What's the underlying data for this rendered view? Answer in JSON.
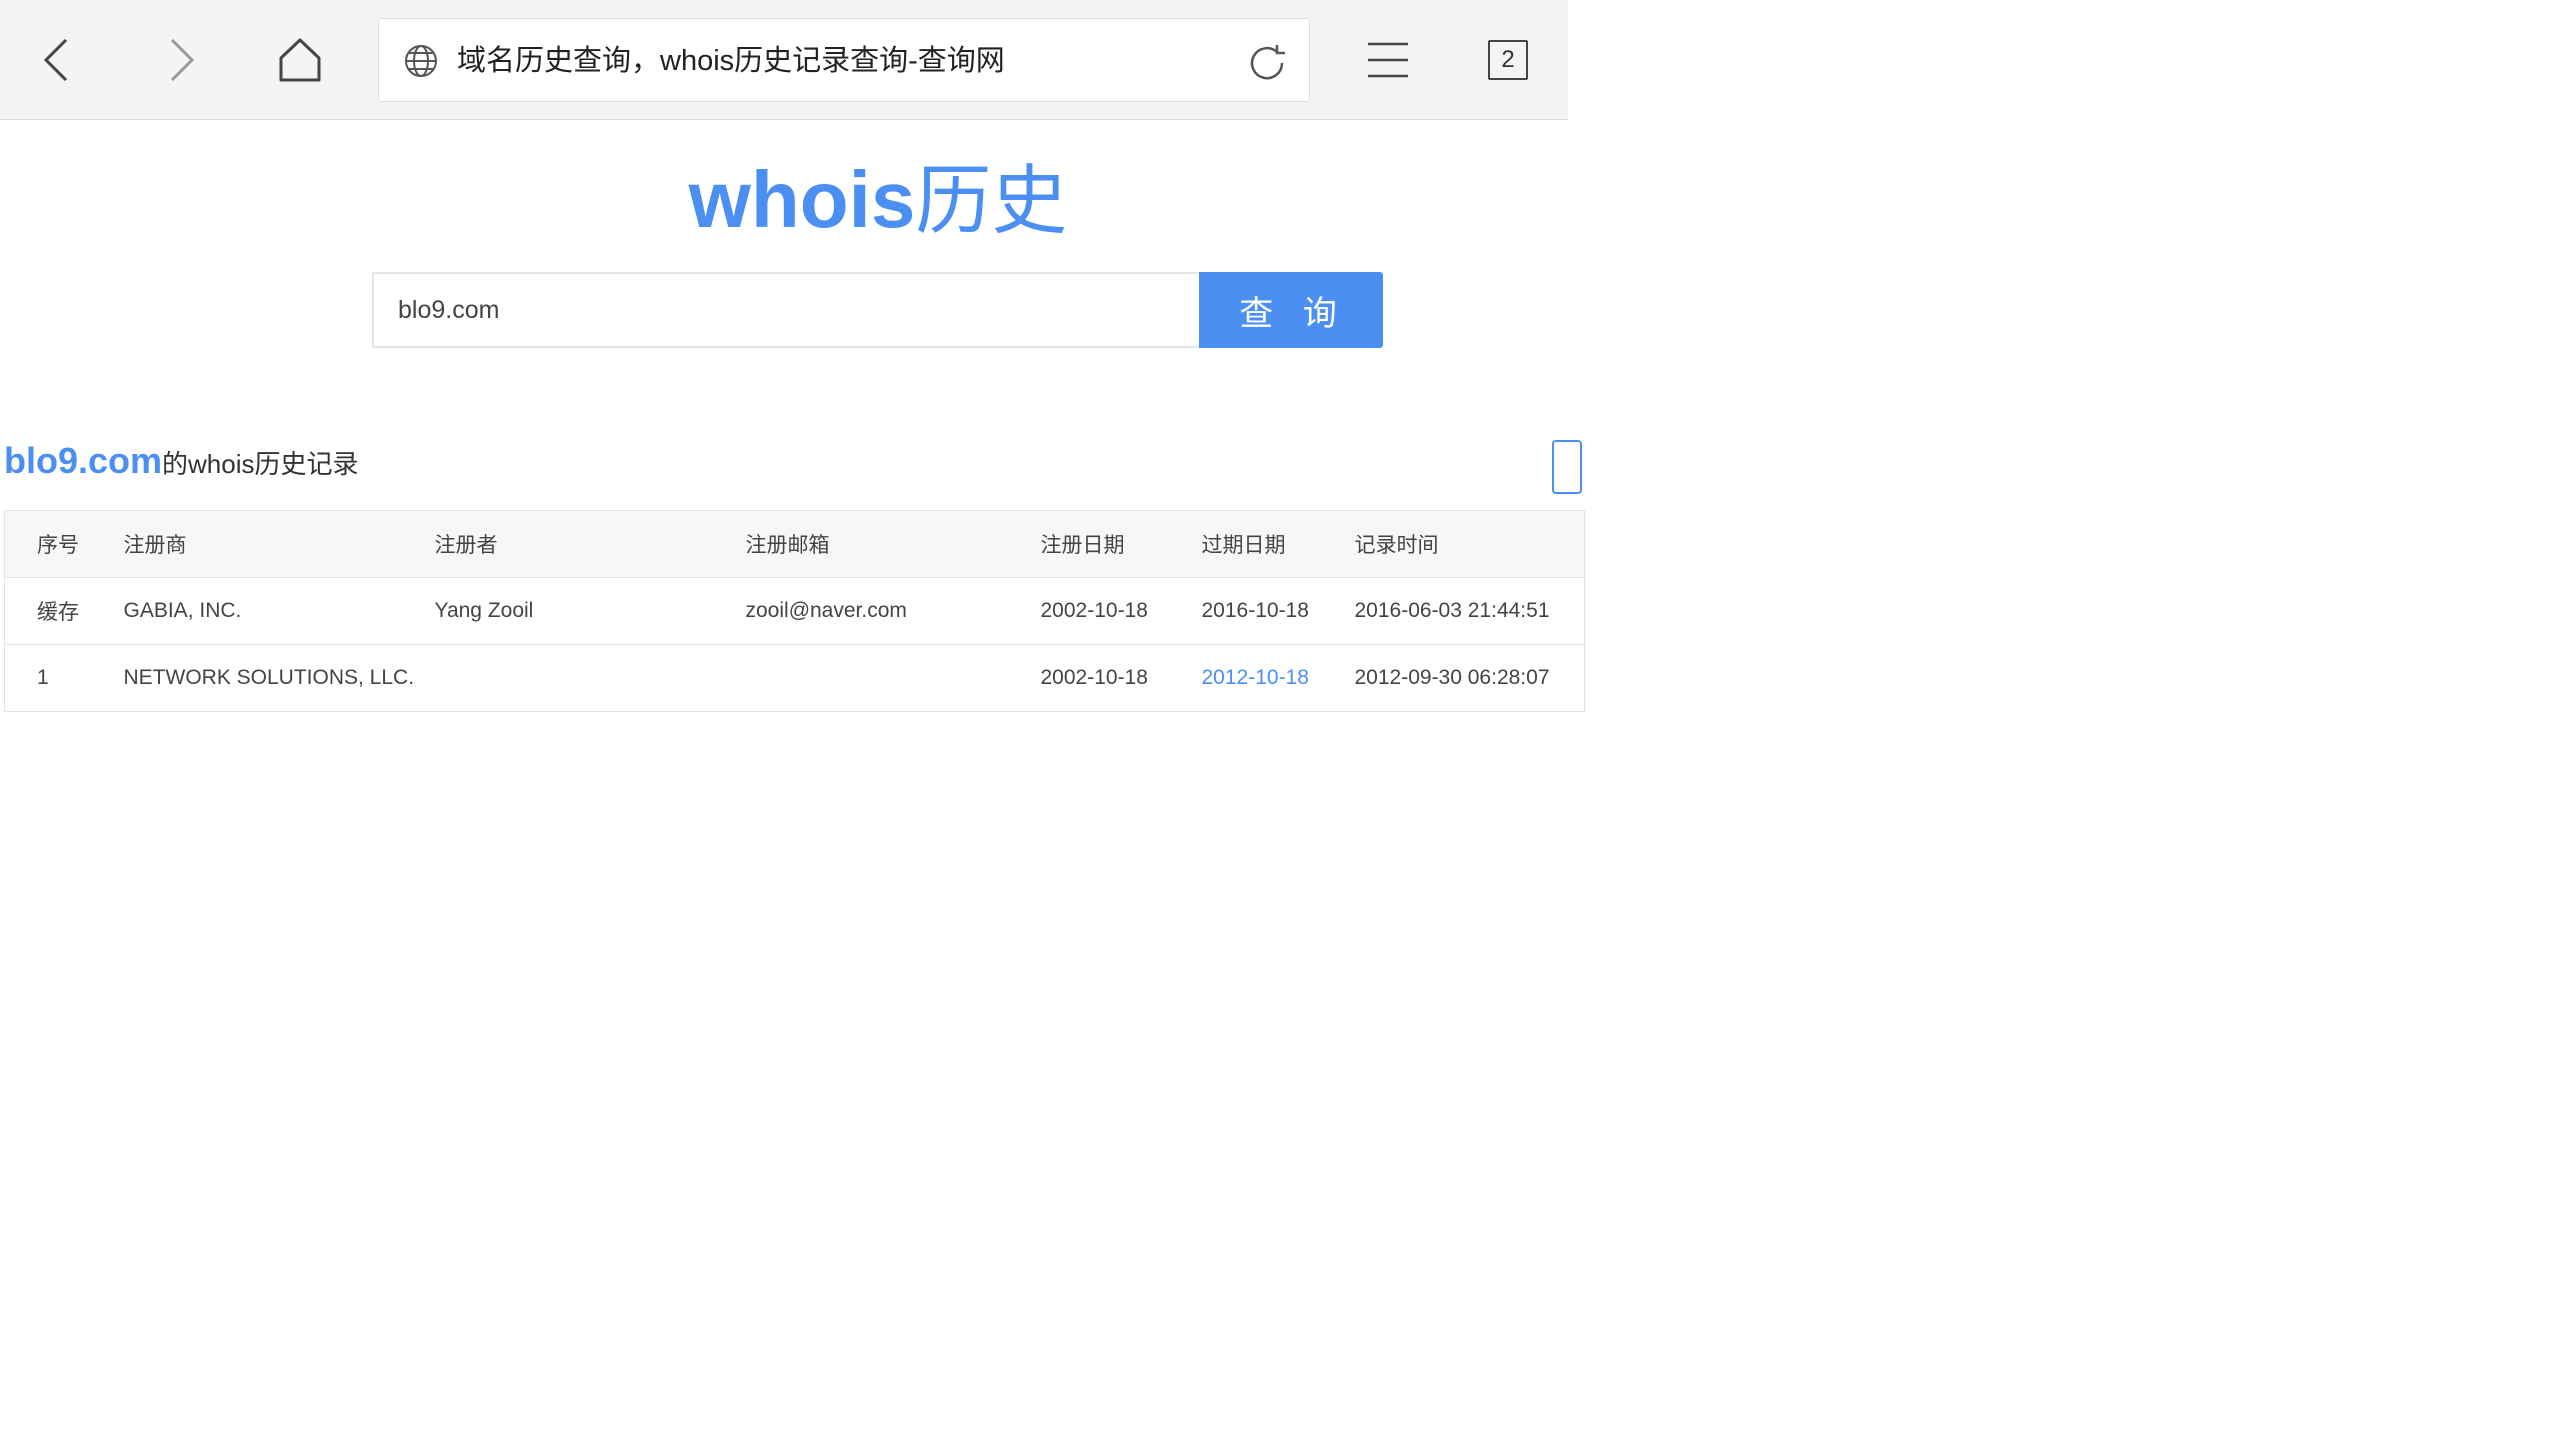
{
  "browser": {
    "tab_title": "域名历史查询，whois历史记录查询-查询网",
    "tab_count": "2"
  },
  "site": {
    "title_latin": "whois",
    "title_cn": "历史"
  },
  "search": {
    "value": "blo9.com",
    "button_label": "查 询"
  },
  "results": {
    "domain": "blo9.com",
    "heading_suffix": "的whois历史记录",
    "columns": [
      "序号",
      "注册商",
      "注册者",
      "注册邮箱",
      "注册日期",
      "过期日期",
      "记录时间"
    ],
    "rows": [
      {
        "index": "缓存",
        "registrar": "GABIA, INC.",
        "registrant": "Yang Zooil",
        "email": "zooil@naver.com",
        "created": "2002-10-18",
        "expires": "2016-10-18",
        "recorded": "2016-06-03 21:44:51"
      },
      {
        "index": "1",
        "registrar": "NETWORK SOLUTIONS, LLC.",
        "registrant": "",
        "email": "",
        "created": "2002-10-18",
        "expires": "2012-10-18",
        "recorded": "2012-09-30 06:28:07"
      }
    ]
  },
  "colors": {
    "accent": "#4b8ff2",
    "toolbar_bg": "#f4f4f4",
    "table_header_bg": "#f7f7f7"
  },
  "icons": {
    "back": "chevron-left-icon",
    "forward": "chevron-right-icon",
    "home": "home-icon",
    "site": "globe-icon",
    "reload": "reload-icon",
    "menu": "menu-icon",
    "tabs": "tabs-icon"
  }
}
